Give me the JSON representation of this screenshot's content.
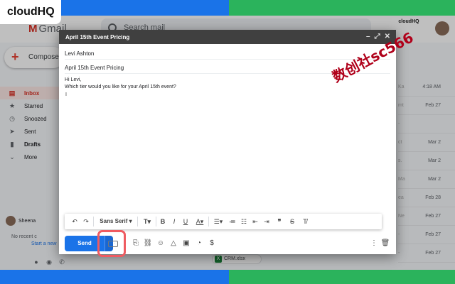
{
  "brand": {
    "badge": "cloudHQ",
    "small_line1": "cloudHQ"
  },
  "gmail": {
    "logo": "Gmail",
    "search_placeholder": "Search mail",
    "compose_label": "Compose",
    "nav": [
      {
        "label": "Inbox",
        "icon": "inbox-icon"
      },
      {
        "label": "Starred",
        "icon": "star-icon"
      },
      {
        "label": "Snoozed",
        "icon": "clock-icon"
      },
      {
        "label": "Sent",
        "icon": "send-icon"
      },
      {
        "label": "Drafts",
        "icon": "file-icon"
      },
      {
        "label": "More",
        "icon": "chevron-down-icon"
      }
    ],
    "hangouts_user": "Sheena",
    "no_recent": "No recent c",
    "start_new": "Start a new",
    "dates": [
      "4:18 AM",
      "Feb 27",
      "Mar 2",
      "Mar 2",
      "Mar 2",
      "Feb 28",
      "Feb 27",
      "Feb 27",
      "Feb 27"
    ],
    "attachment": "CRM.xlsx"
  },
  "compose": {
    "title": "April 15th Event Pricing",
    "to": "Levi Ashton",
    "subject": "April 15th Event Pricing",
    "body_line1": "Hi Levi,",
    "body_line2": "Which tier would you like for your April 15th event?",
    "cursor": "I",
    "font_name": "Sans Serif",
    "send_label": "Send"
  },
  "watermark": "数创社sc566",
  "colors": {
    "send_blue": "#1a73e8",
    "highlight_red": "#ef5b61",
    "title_bar": "#404040",
    "bg_left": "#1a73e8",
    "bg_right": "#2bb35c"
  }
}
